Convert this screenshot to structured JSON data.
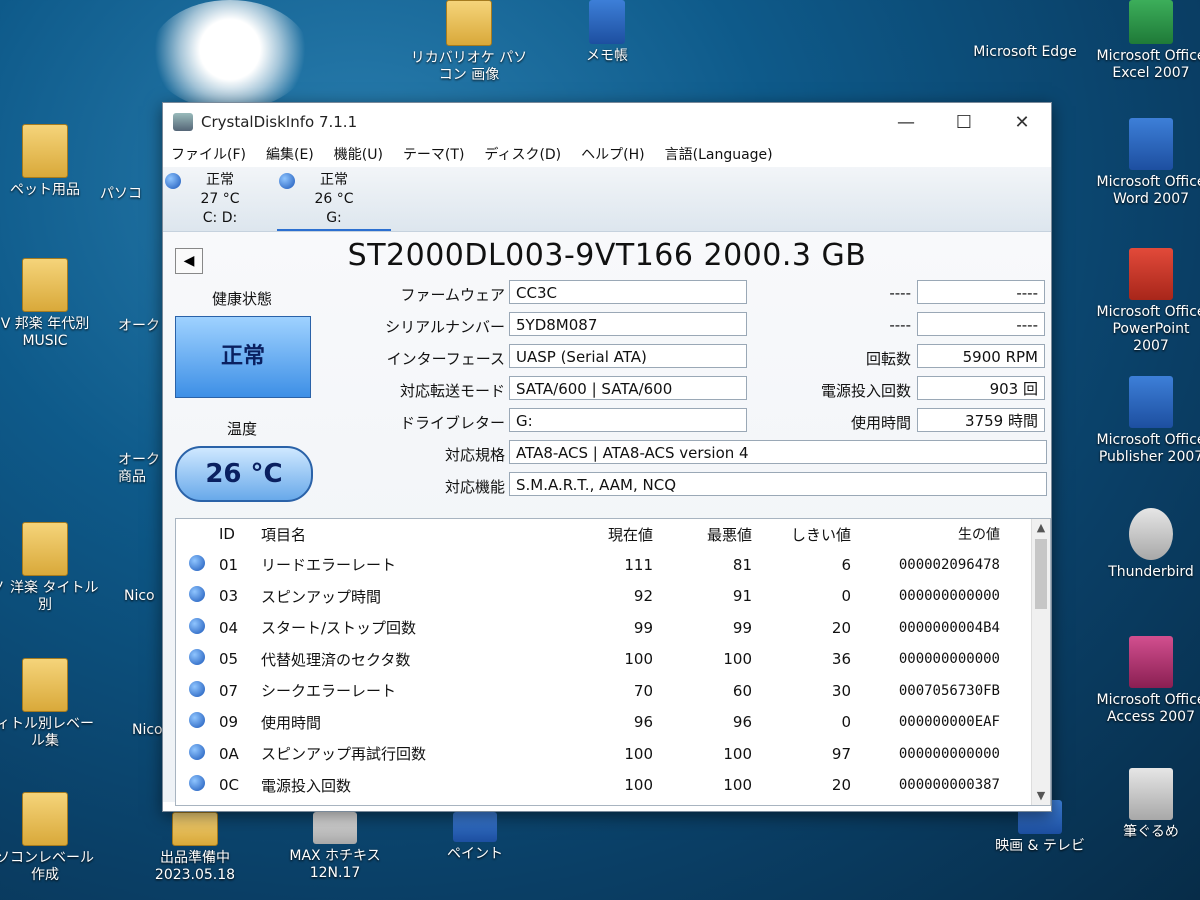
{
  "desktop": {
    "left_icons": [
      {
        "label": "ペット用品"
      },
      {
        "label": "V 邦楽 年代別 MUSIC"
      },
      {
        "label": "ノ 洋楽 タイトル別"
      },
      {
        "label": "ィトル別レベール集"
      },
      {
        "label": "ソコンレベール作成"
      }
    ],
    "top_icons": [
      {
        "label": "リカバリオケ パソコン 画像"
      },
      {
        "label": "メモ帳"
      }
    ],
    "right_icons": [
      {
        "label": "Microsoft Office Excel 2007"
      },
      {
        "label": "Microsoft Office Word 2007"
      },
      {
        "label": "Microsoft Office PowerPoint 2007"
      },
      {
        "label": "Microsoft Office Publisher 2007"
      },
      {
        "label": "Thunderbird"
      },
      {
        "label": "Microsoft Office Access 2007"
      },
      {
        "label": "筆ぐるめ"
      }
    ],
    "bottom_icons": [
      {
        "label": "出品準備中 2023.05.18"
      },
      {
        "label": "MAX ホチキス 12N.17"
      },
      {
        "label": "ペイント"
      },
      {
        "label": "映画 & テレビ"
      }
    ],
    "misc_labels": {
      "edge": "Microsoft Edge",
      "left2": "パソコ",
      "left3": "オーク",
      "left4": "オーク 商品",
      "left5": "Nico",
      "left6": "Nico"
    }
  },
  "window": {
    "title": "CrystalDiskInfo 7.1.1",
    "controls": {
      "minimize": "—",
      "maximize": "☐",
      "close": "✕"
    },
    "menu": [
      "ファイル(F)",
      "編集(E)",
      "機能(U)",
      "テーマ(T)",
      "ディスク(D)",
      "ヘルプ(H)",
      "言語(Language)"
    ],
    "drives": [
      {
        "status": "正常",
        "temp": "27 °C",
        "letter": "C: D:"
      },
      {
        "status": "正常",
        "temp": "26 °C",
        "letter": "G:"
      }
    ],
    "model": "ST2000DL003-9VT166 2000.3 GB",
    "health_label": "健康状態",
    "health_value": "正常",
    "temp_label": "温度",
    "temp_value": "26 °C",
    "fields": {
      "firmware_label": "ファームウェア",
      "firmware": "CC3C",
      "serial_label": "シリアルナンバー",
      "serial": "5YD8M087",
      "interface_label": "インターフェース",
      "interface": "UASP (Serial ATA)",
      "transfer_label": "対応転送モード",
      "transfer": "SATA/600 | SATA/600",
      "letter_label": "ドライブレター",
      "letter": "G:",
      "standard_label": "対応規格",
      "standard": "ATA8-ACS | ATA8-ACS version 4",
      "features_label": "対応機能",
      "features": "S.M.A.R.T., AAM, NCQ",
      "blank1_label": "----",
      "blank1": "----",
      "blank2_label": "----",
      "blank2": "----",
      "rpm_label": "回転数",
      "rpm": "5900 RPM",
      "power_count_label": "電源投入回数",
      "power_count": "903 回",
      "hours_label": "使用時間",
      "hours": "3759 時間"
    },
    "smart": {
      "headers": [
        "ID",
        "項目名",
        "現在値",
        "最悪値",
        "しきい値",
        "生の値"
      ],
      "rows": [
        {
          "id": "01",
          "name": "リードエラーレート",
          "cur": "111",
          "worst": "81",
          "thr": "6",
          "raw": "000002096478"
        },
        {
          "id": "03",
          "name": "スピンアップ時間",
          "cur": "92",
          "worst": "91",
          "thr": "0",
          "raw": "000000000000"
        },
        {
          "id": "04",
          "name": "スタート/ストップ回数",
          "cur": "99",
          "worst": "99",
          "thr": "20",
          "raw": "0000000004B4"
        },
        {
          "id": "05",
          "name": "代替処理済のセクタ数",
          "cur": "100",
          "worst": "100",
          "thr": "36",
          "raw": "000000000000"
        },
        {
          "id": "07",
          "name": "シークエラーレート",
          "cur": "70",
          "worst": "60",
          "thr": "30",
          "raw": "0007056730FB"
        },
        {
          "id": "09",
          "name": "使用時間",
          "cur": "96",
          "worst": "96",
          "thr": "0",
          "raw": "000000000EAF"
        },
        {
          "id": "0A",
          "name": "スピンアップ再試行回数",
          "cur": "100",
          "worst": "100",
          "thr": "97",
          "raw": "000000000000"
        },
        {
          "id": "0C",
          "name": "電源投入回数",
          "cur": "100",
          "worst": "100",
          "thr": "20",
          "raw": "000000000387"
        }
      ]
    }
  }
}
